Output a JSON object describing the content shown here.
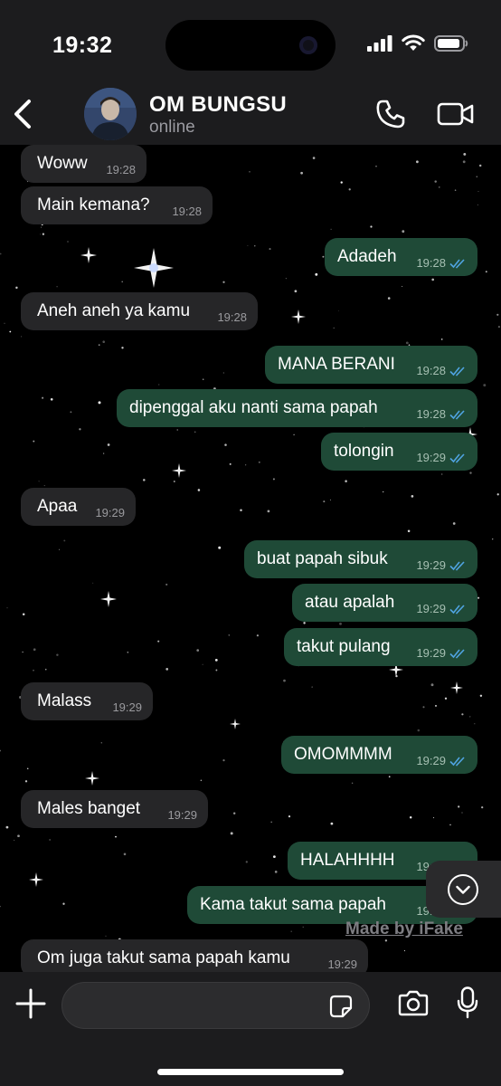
{
  "status_bar": {
    "time": "19:32"
  },
  "header": {
    "contact_name": "OM BUNGSU",
    "contact_status": "online"
  },
  "messages": [
    {
      "dir": "in",
      "text": "Woww",
      "time": "19:28"
    },
    {
      "dir": "in",
      "text": "Main kemana?",
      "time": "19:28"
    },
    {
      "dir": "out",
      "text": "Adadeh",
      "time": "19:28"
    },
    {
      "dir": "in",
      "text": "Aneh aneh ya kamu",
      "time": "19:28"
    },
    {
      "dir": "out",
      "text": "MANA BERANI",
      "time": "19:28"
    },
    {
      "dir": "out",
      "text": "dipenggal aku nanti sama papah",
      "time": "19:28"
    },
    {
      "dir": "out",
      "text": "tolongin",
      "time": "19:29"
    },
    {
      "dir": "in",
      "text": "Apaa",
      "time": "19:29"
    },
    {
      "dir": "out",
      "text": "buat papah sibuk",
      "time": "19:29"
    },
    {
      "dir": "out",
      "text": "atau apalah",
      "time": "19:29"
    },
    {
      "dir": "out",
      "text": "takut pulang",
      "time": "19:29"
    },
    {
      "dir": "in",
      "text": "Malass",
      "time": "19:29"
    },
    {
      "dir": "out",
      "text": "OMOMMMM",
      "time": "19:29"
    },
    {
      "dir": "in",
      "text": "Males banget",
      "time": "19:29"
    },
    {
      "dir": "out",
      "text": "HALAHHHH",
      "time": "19:29"
    },
    {
      "dir": "out",
      "text": "Kama takut sama papah",
      "time": "19:29"
    },
    {
      "dir": "in",
      "text": "Om juga takut sama papah kamu",
      "time": "19:29"
    }
  ],
  "watermark": "Made by iFake",
  "icons": {
    "back": "chevron-left-icon",
    "call": "phone-icon",
    "video": "video-camera-icon",
    "scroll_down": "chevron-down-icon",
    "add": "plus-icon",
    "sticker": "sticker-icon",
    "camera": "camera-icon",
    "mic": "microphone-icon",
    "read_receipt": "double-check-icon"
  },
  "colors": {
    "outgoing_bubble": "#1f4a37",
    "incoming_bubble": "#262628",
    "read_tick": "#4fa3e0",
    "bar_background": "#1c1c1e"
  }
}
